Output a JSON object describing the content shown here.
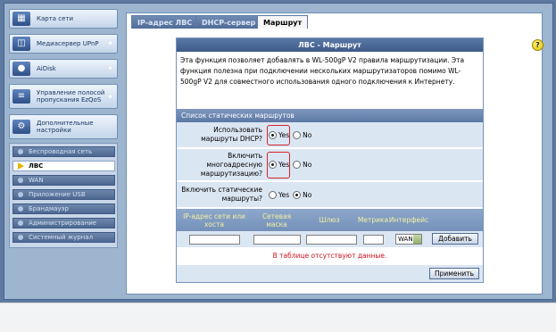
{
  "sidebar": {
    "menu": [
      {
        "label": "Карта сети",
        "icon": "network-map-icon"
      },
      {
        "label": "Медиасервер UPnP",
        "icon": "media-server-icon"
      },
      {
        "label": "AiDisk",
        "icon": "aidisk-icon"
      },
      {
        "label": "Управление полосой пропускания EzQoS",
        "icon": "qos-icon"
      },
      {
        "label": "Дополнительные настройки",
        "icon": "advanced-settings-icon"
      }
    ],
    "submenu": [
      {
        "label": "Беспроводная сеть",
        "active": false
      },
      {
        "label": "ЛВС",
        "active": true
      },
      {
        "label": "WAN",
        "active": false
      },
      {
        "label": "Приложение USB",
        "active": false
      },
      {
        "label": "Брандмауэр",
        "active": false
      },
      {
        "label": "Администрирование",
        "active": false
      },
      {
        "label": "Системный журнал",
        "active": false
      }
    ]
  },
  "tabs": [
    {
      "label": "IP-адрес ЛВС",
      "active": false
    },
    {
      "label": "DHCP-сервер",
      "active": false
    },
    {
      "label": "Маршрут",
      "active": true
    }
  ],
  "help": {
    "label": "?"
  },
  "panel": {
    "title": "ЛВС - Маршрут",
    "description": "Эта функция позволяет добавлять в WL-500gP V2 правила маршрутизации. Эта функция полезна при подключении нескольких маршрутизаторов помимо WL-500gP V2 для совместного использования одного подключения к Интернету.",
    "section": "Список статических маршрутов",
    "fields": [
      {
        "label": "Использовать маршруты DHCP?",
        "yes": "Yes",
        "no": "No",
        "selected": "Yes"
      },
      {
        "label": "Включить многоадресную маршрутизацию?",
        "yes": "Yes",
        "no": "No",
        "selected": "Yes"
      },
      {
        "label": "Включить статические маршруты?",
        "yes": "Yes",
        "no": "No",
        "selected": "No"
      }
    ],
    "table": {
      "columns": [
        "IP-адрес сети или хоста",
        "Сетевая маска",
        "Шлюз",
        "Метрика",
        "Интерфейс"
      ],
      "interface_value": "WAN",
      "add_button": "Добавить",
      "empty_message": "В таблице отсутствуют данные."
    },
    "apply_button": "Применить"
  },
  "colors": {
    "accent": "#3e5b88",
    "highlight": "#d4232b",
    "empty_message": "#d0121b"
  }
}
